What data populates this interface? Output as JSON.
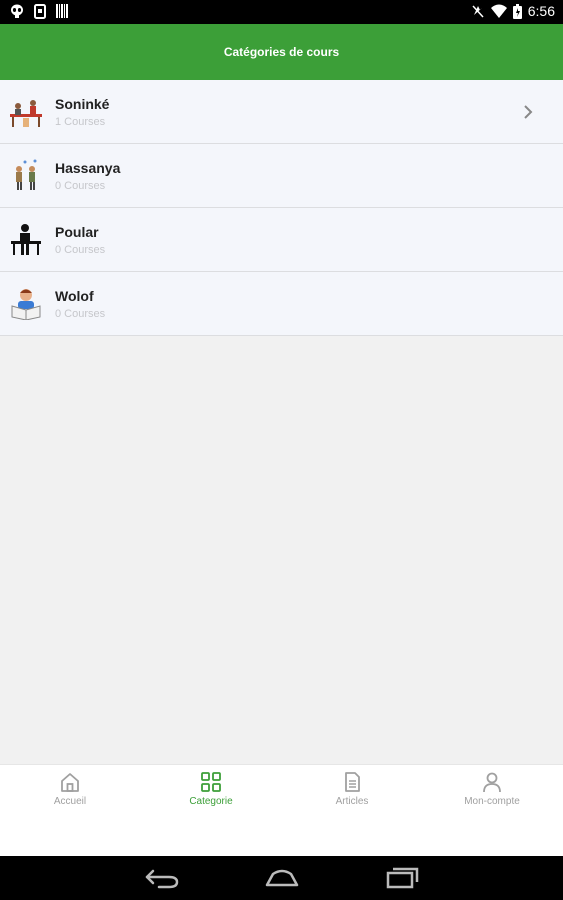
{
  "status_bar": {
    "time": "6:56",
    "left_icons": [
      "alien-icon",
      "phone-screen-icon",
      "barcode-icon"
    ],
    "right_icons": [
      "mute-icon",
      "wifi-icon",
      "battery-icon"
    ]
  },
  "header": {
    "title": "Catégories de cours"
  },
  "categories": [
    {
      "name": "Soninké",
      "count": "1 Courses",
      "icon": "classroom-icon"
    },
    {
      "name": "Hassanya",
      "count": "0 Courses",
      "icon": "people-talking-icon"
    },
    {
      "name": "Poular",
      "count": "0 Courses",
      "icon": "person-at-desk-icon"
    },
    {
      "name": "Wolof",
      "count": "0 Courses",
      "icon": "student-reading-icon"
    }
  ],
  "bottom_nav": {
    "items": [
      {
        "label": "Accueil",
        "icon": "home-icon",
        "active": false
      },
      {
        "label": "Categorie",
        "icon": "grid-icon",
        "active": true
      },
      {
        "label": "Articles",
        "icon": "document-icon",
        "active": false
      },
      {
        "label": "Mon-compte",
        "icon": "user-icon",
        "active": false
      }
    ]
  },
  "colors": {
    "primary": "#3c9f38",
    "list_background": "#f4f6fb",
    "page_background": "#f1f1f1",
    "inactive_nav": "#a0a0a0"
  }
}
